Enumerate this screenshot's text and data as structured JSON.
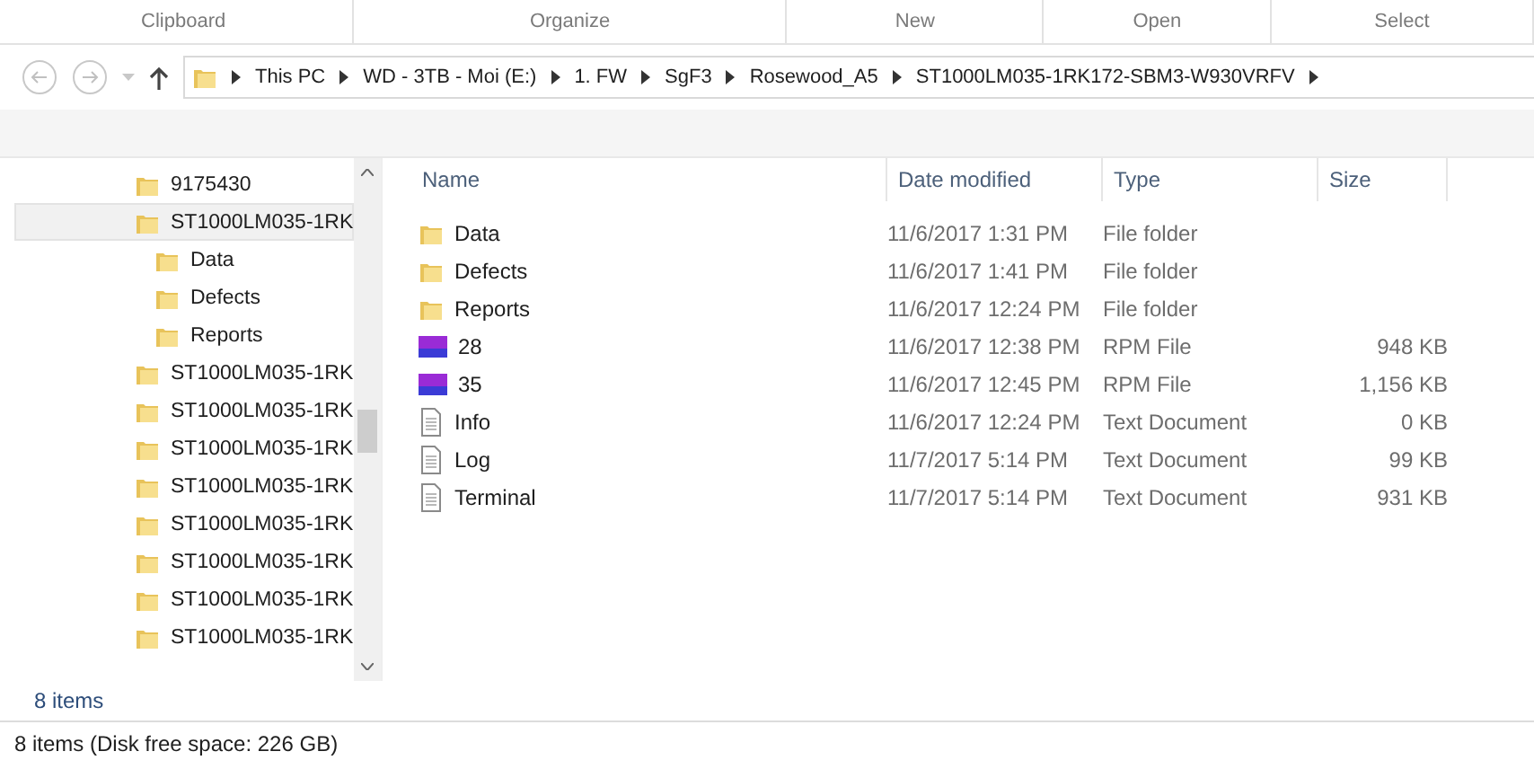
{
  "ribbon_groups": [
    "Clipboard",
    "Organize",
    "New",
    "Open",
    "Select"
  ],
  "address_bar": {
    "path": [
      "This PC",
      "WD - 3TB - Moi (E:)",
      "1. FW",
      "SgF3",
      "Rosewood_A5",
      "ST1000LM035-1RK172-SBM3-W930VRFV"
    ]
  },
  "navigation_pane": {
    "items": [
      {
        "label": "9175430",
        "selected": false
      },
      {
        "label": "ST1000LM035-1RK",
        "selected": true,
        "children": [
          {
            "label": "Data",
            "selected": false
          },
          {
            "label": "Defects",
            "selected": false
          },
          {
            "label": "Reports",
            "selected": false
          }
        ]
      },
      {
        "label": "ST1000LM035-1RK",
        "selected": false
      },
      {
        "label": "ST1000LM035-1RK",
        "selected": false
      },
      {
        "label": "ST1000LM035-1RK",
        "selected": false
      },
      {
        "label": "ST1000LM035-1RK",
        "selected": false
      },
      {
        "label": "ST1000LM035-1RK",
        "selected": false
      },
      {
        "label": "ST1000LM035-1RK",
        "selected": false
      },
      {
        "label": "ST1000LM035-1RK",
        "selected": false
      },
      {
        "label": "ST1000LM035-1RK",
        "selected": false
      }
    ],
    "item_count": "8 items"
  },
  "file_list": {
    "columns": [
      "Name",
      "Date modified",
      "Type",
      "Size"
    ],
    "rows": [
      {
        "kind": "folder",
        "name": "Data",
        "date": "11/6/2017 1:31 PM",
        "type": "File folder"
      },
      {
        "kind": "folder",
        "name": "Defects",
        "date": "11/6/2017 1:41 PM",
        "type": "File folder"
      },
      {
        "kind": "folder",
        "name": "Reports",
        "date": "11/6/2017 12:24 PM",
        "type": "File folder"
      },
      {
        "kind": "hex",
        "name": "28",
        "date": "11/6/2017 12:38 PM",
        "type": "RPM File",
        "size": "948 KB"
      },
      {
        "kind": "hex",
        "name": "35",
        "date": "11/6/2017 12:45 PM",
        "type": "RPM File",
        "size": "1,156 KB"
      },
      {
        "kind": "text",
        "name": "Info",
        "date": "11/6/2017 12:24 PM",
        "type": "Text Document",
        "size": "0 KB"
      },
      {
        "kind": "text",
        "name": "Log",
        "date": "11/7/2017 5:14 PM",
        "type": "Text Document",
        "size": "99 KB"
      },
      {
        "kind": "text",
        "name": "Terminal",
        "date": "11/7/2017 5:14 PM",
        "type": "Text Document",
        "size": "931 KB"
      }
    ]
  },
  "status_bar": "8 items (Disk free space: 226 GB)"
}
